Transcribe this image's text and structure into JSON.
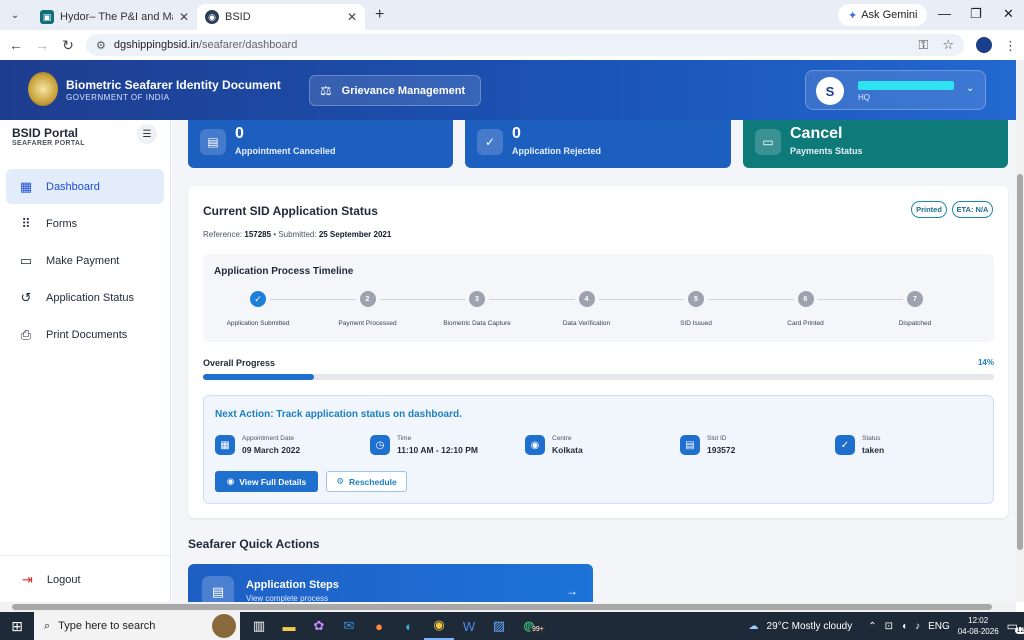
{
  "browser": {
    "tabs": [
      {
        "title": "Hydor– The P&I and Marine Lia",
        "active": false
      },
      {
        "title": "BSID",
        "active": true
      }
    ],
    "new_tab": "+",
    "gemini_label": "Ask Gemini",
    "url_host": "dgshippingbsid.in",
    "url_path": "/seafarer/dashboard"
  },
  "header": {
    "title": "Biometric Seafarer Identity Document",
    "subtitle": "GOVERNMENT OF INDIA",
    "grievance_label": "Grievance Management",
    "user_initial": "S",
    "user_role": "HQ"
  },
  "sidebar": {
    "title": "BSID Portal",
    "subtitle": "SEAFARER PORTAL",
    "items": [
      {
        "label": "Dashboard",
        "icon": "dashboard-icon",
        "active": true
      },
      {
        "label": "Forms",
        "icon": "grid-icon",
        "active": false
      },
      {
        "label": "Make Payment",
        "icon": "card-icon",
        "active": false
      },
      {
        "label": "Application Status",
        "icon": "history-icon",
        "active": false
      },
      {
        "label": "Print Documents",
        "icon": "printer-icon",
        "active": false
      }
    ],
    "logout_label": "Logout"
  },
  "stats": [
    {
      "value": "0",
      "label": "Appointment Cancelled",
      "icon": "document-icon",
      "color": "#1d5fbf"
    },
    {
      "value": "0",
      "label": "Application Rejected",
      "icon": "check-circle-icon",
      "color": "#1d5fbf"
    },
    {
      "value": "Cancel",
      "label": "Payments Status",
      "icon": "card-icon",
      "color": "#0f7a7a"
    }
  ],
  "application": {
    "title": "Current SID Application Status",
    "reference_label": "Reference:",
    "reference": "157285",
    "submitted_label": "• Submitted:",
    "submitted": "25 September 2021",
    "badges": [
      "Printed",
      "ETA: N/A"
    ],
    "timeline_title": "Application Process Timeline",
    "steps": [
      {
        "number": "1",
        "label": "Application Submitted",
        "done": true
      },
      {
        "number": "2",
        "label": "Payment Processed",
        "done": false
      },
      {
        "number": "3",
        "label": "Biometric Data Capture",
        "done": false
      },
      {
        "number": "4",
        "label": "Data Verification",
        "done": false
      },
      {
        "number": "5",
        "label": "SID Issued",
        "done": false
      },
      {
        "number": "6",
        "label": "Card Printed",
        "done": false
      },
      {
        "number": "7",
        "label": "Dispatched",
        "done": false
      }
    ],
    "progress_label": "Overall Progress",
    "progress_text": "14%",
    "progress_fraction": 0.14,
    "next_action": "Next Action: Track application status on dashboard.",
    "details": [
      {
        "label": "Appointment Date",
        "value": "09 March 2022",
        "icon": "calendar-icon"
      },
      {
        "label": "Time",
        "value": "11:10 AM - 12:10 PM",
        "icon": "clock-icon"
      },
      {
        "label": "Centre",
        "value": "Kolkata",
        "icon": "location-icon"
      },
      {
        "label": "Slot ID",
        "value": "193572",
        "icon": "document-icon"
      },
      {
        "label": "Status",
        "value": "taken",
        "icon": "check-circle-icon"
      }
    ],
    "view_details_label": "View Full Details",
    "reschedule_label": "Reschedule"
  },
  "quick_actions": {
    "title": "Seafarer Quick Actions",
    "card_title": "Application Steps",
    "card_subtitle": "View complete process"
  },
  "taskbar": {
    "search_placeholder": "Type here to search",
    "weather": "29°C  Mostly cloudy",
    "lang": "ENG",
    "time": "12:02",
    "date": "04-08-2026",
    "notif_count": "12",
    "whatsapp_badge": "99+"
  }
}
